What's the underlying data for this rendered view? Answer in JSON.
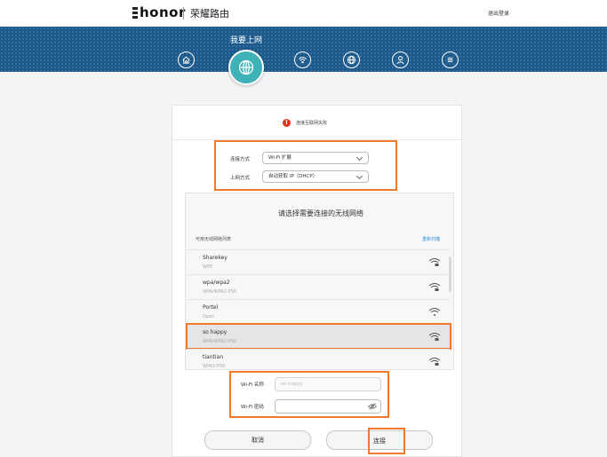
{
  "header": {
    "brand_logo": "honor",
    "product_name": "荣耀路由",
    "logout_label": "退出登录"
  },
  "nav": {
    "title": "我要上网",
    "icons": [
      "home-icon",
      "globe-icon",
      "wifi-icon",
      "network-icon",
      "user-icon",
      "menu-icon"
    ],
    "active": "globe-icon"
  },
  "status": {
    "text": "连接互联网失败"
  },
  "form": {
    "connection_mode_label": "连接方式",
    "connection_mode_value": "Wi-Fi 扩展",
    "internet_mode_label": "上网方式",
    "internet_mode_value": "自动获取 IP（DHCP）"
  },
  "wifi_panel": {
    "heading": "请选择需要连接的无线网络",
    "list_header": "可用无线网络列表",
    "rescan_label": "重新扫描",
    "networks": [
      {
        "ssid": "Sharekey",
        "security": "WEP",
        "locked": true
      },
      {
        "ssid": "wpa/wpa2",
        "security": "WPA/WPA2-PSK",
        "locked": true
      },
      {
        "ssid": "Portel",
        "security": "Open",
        "locked": false
      },
      {
        "ssid": "so happy",
        "security": "WPA/WPA2-PSK",
        "locked": true,
        "selected": true
      },
      {
        "ssid": "tiantian",
        "security": "WPA2-PSK",
        "locked": true
      }
    ]
  },
  "wifi_form": {
    "name_label": "Wi-Fi 名称",
    "name_value": "so happy",
    "password_label": "Wi-Fi 密码",
    "password_value": ""
  },
  "actions": {
    "cancel_label": "取消",
    "connect_label": "连接"
  },
  "colors": {
    "nav_background": "#1c5a8d",
    "active_icon": "#3fb2b8",
    "highlight": "#f07a2b",
    "link": "#2c8fd0",
    "error": "#e0321e"
  }
}
